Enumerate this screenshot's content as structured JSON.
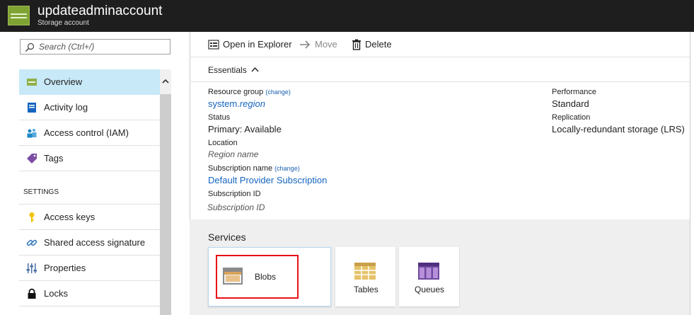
{
  "header": {
    "title": "updateadminaccount",
    "subtitle": "Storage account",
    "accent_color": "#7fa332"
  },
  "sidebar": {
    "search_placeholder": "Search (Ctrl+/)",
    "items": [
      {
        "label": "Overview",
        "icon": "overview-icon",
        "active": true
      },
      {
        "label": "Activity log",
        "icon": "activity-log-icon"
      },
      {
        "label": "Access control (IAM)",
        "icon": "iam-icon"
      },
      {
        "label": "Tags",
        "icon": "tag-icon"
      }
    ],
    "section": "SETTINGS",
    "settings_items": [
      {
        "label": "Access keys",
        "icon": "key-icon"
      },
      {
        "label": "Shared access signature",
        "icon": "link-icon"
      },
      {
        "label": "Properties",
        "icon": "properties-icon"
      },
      {
        "label": "Locks",
        "icon": "lock-icon"
      }
    ]
  },
  "toolbar": {
    "open_in_explorer": "Open in Explorer",
    "move": "Move",
    "delete": "Delete"
  },
  "essentials": {
    "label": "Essentials",
    "change": "(change)",
    "resource_group_label": "Resource group",
    "resource_group_value_prefix": "system.",
    "resource_group_value_suffix": "region",
    "status_label": "Status",
    "status_value": "Primary: Available",
    "location_label": "Location",
    "location_value": "Region name",
    "subscription_name_label": "Subscription name",
    "subscription_name_value": "Default Provider Subscription",
    "subscription_id_label": "Subscription ID",
    "subscription_id_value": "Subscription ID",
    "performance_label": "Performance",
    "performance_value": "Standard",
    "replication_label": "Replication",
    "replication_value": "Locally-redundant storage (LRS)"
  },
  "services": {
    "title": "Services",
    "tiles": [
      {
        "label": "Blobs",
        "icon": "blobs-icon",
        "highlighted": true
      },
      {
        "label": "Tables",
        "icon": "tables-icon"
      },
      {
        "label": "Queues",
        "icon": "queues-icon"
      }
    ],
    "highlight_color": "#e8121a"
  }
}
